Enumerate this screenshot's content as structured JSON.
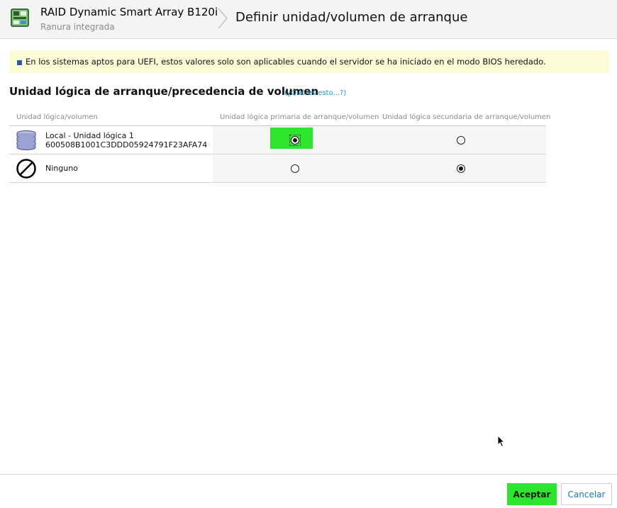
{
  "header": {
    "title": "RAID Dynamic Smart Array B120i",
    "subtitle": "Ranura integrada",
    "page_title": "Definir unidad/volumen de arranque",
    "controller_icon": "storage-controller-icon"
  },
  "note": {
    "text": "En los sistemas aptos para UEFI, estos valores solo son aplicables cuando el servidor se ha iniciado en el modo BIOS heredado."
  },
  "section": {
    "title": "Unidad lógica de arranque/precedencia de volumen",
    "help_link": "(¿Qué es esto...?)"
  },
  "table": {
    "columns": [
      "Unidad lógica/volumen",
      "Unidad lógica primaria de arranque/volumen",
      "Unidad lógica secundaria de arranque/volumen"
    ],
    "rows": [
      {
        "icon": "logical-drive-icon",
        "label_line1": "Local - Unidad lógica 1",
        "label_line2": "600508B1001C3DDD05924791F23AFA74",
        "primary_selected": true,
        "secondary_selected": false
      },
      {
        "icon": "none-icon",
        "label_line1": "Ninguno",
        "primary_selected": false,
        "secondary_selected": true
      }
    ]
  },
  "footer": {
    "accept_label": "Aceptar",
    "cancel_label": "Cancelar"
  },
  "colors": {
    "accent_green": "#2ee52e",
    "link_blue": "#1a9bd7",
    "note_bg": "#fdfbd8"
  }
}
